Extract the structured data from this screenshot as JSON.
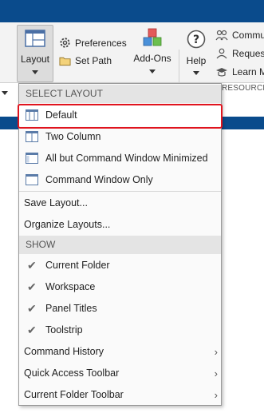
{
  "toolbar": {
    "layout": {
      "label": "Layout",
      "icon": "layout-icon"
    },
    "preferences": {
      "label": "Preferences",
      "icon": "gear-icon"
    },
    "set_path": {
      "label": "Set Path",
      "icon": "folder-icon"
    },
    "addons": {
      "label": "Add-Ons",
      "icon": "addons-icon"
    },
    "help": {
      "label": "Help",
      "icon": "help-icon"
    },
    "community": {
      "label": "Commu",
      "icon": "community-icon"
    },
    "request": {
      "label": "Reques",
      "icon": "request-icon"
    },
    "learn": {
      "label": "Learn M",
      "icon": "learn-icon"
    },
    "resources_caption": "RESOURCE"
  },
  "menu": {
    "select_layout_header": "SELECT LAYOUT",
    "layouts": [
      {
        "label": "Default",
        "icon": "layout-default-icon"
      },
      {
        "label": "Two Column",
        "icon": "layout-two-column-icon"
      },
      {
        "label": "All but Command Window Minimized",
        "icon": "layout-minimized-icon"
      },
      {
        "label": "Command Window Only",
        "icon": "layout-command-window-icon"
      }
    ],
    "save_layout": "Save Layout...",
    "organize_layouts": "Organize Layouts...",
    "show_header": "SHOW",
    "show_items": [
      {
        "label": "Current Folder",
        "checked": true
      },
      {
        "label": "Workspace",
        "checked": true
      },
      {
        "label": "Panel Titles",
        "checked": true
      },
      {
        "label": "Toolstrip",
        "checked": true
      }
    ],
    "submenus": [
      {
        "label": "Command History"
      },
      {
        "label": "Quick Access Toolbar"
      },
      {
        "label": "Current Folder Toolbar"
      }
    ],
    "check_glyph": "✔",
    "arrow_glyph": "›"
  },
  "colors": {
    "title_bar": "#0a4b8c",
    "highlight_border": "#e0141e"
  }
}
